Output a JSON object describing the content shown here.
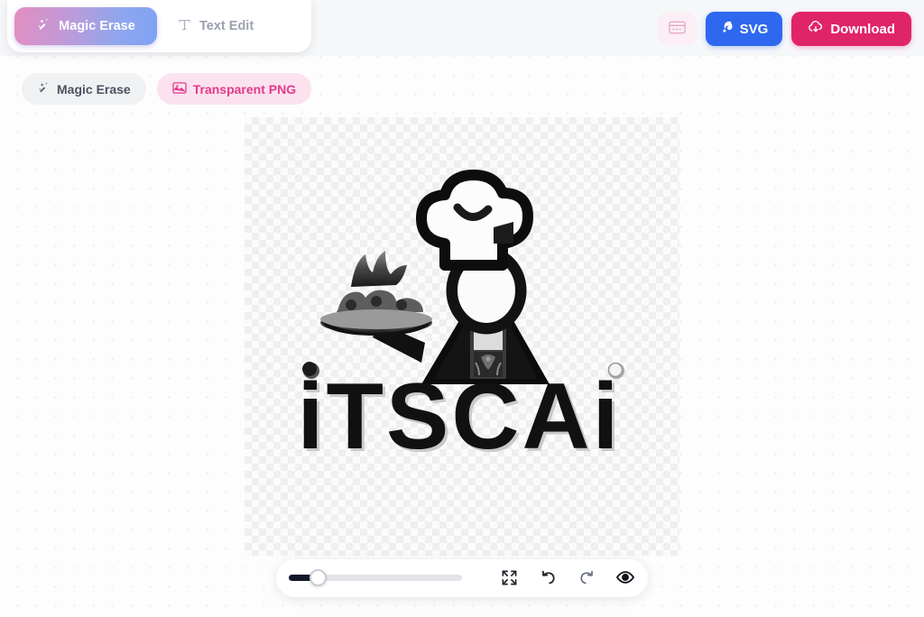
{
  "header": {
    "tabs": [
      {
        "label": "Magic Erase",
        "icon": "magic-wand-icon",
        "active": true
      },
      {
        "label": "Text Edit",
        "icon": "text-type-icon",
        "active": false
      }
    ],
    "actions": {
      "card_button": {
        "label": "",
        "icon": "credit-card-icon"
      },
      "svg_button": {
        "label": "SVG",
        "icon": "magic-swirl-icon",
        "color": "#2e68ee"
      },
      "download_button": {
        "label": "Download",
        "icon": "cloud-download-icon",
        "color": "#e02468"
      }
    }
  },
  "subbar": {
    "chips": [
      {
        "label": "Magic Erase",
        "icon": "magic-wand-icon",
        "active": false
      },
      {
        "label": "Transparent PNG",
        "icon": "transparent-image-icon",
        "active": true
      }
    ]
  },
  "canvas": {
    "artwork_alt": "iTSCAi chef logo",
    "logo_text": "iTSCAi",
    "background": "transparent-checkerboard"
  },
  "bottombar": {
    "zoom": {
      "value": 12,
      "min": 0,
      "max": 100
    },
    "buttons": [
      {
        "name": "fit-to-screen",
        "icon": "expand-icon"
      },
      {
        "name": "undo",
        "icon": "undo-arrow-icon"
      },
      {
        "name": "redo",
        "icon": "redo-arrow-icon"
      },
      {
        "name": "preview",
        "icon": "eye-icon"
      }
    ]
  },
  "colors": {
    "accent_pink": "#e02468",
    "accent_blue": "#2e68ee",
    "chip_pink_bg": "#fbe2ee",
    "chip_pink_text": "#e5398c",
    "page_bg": "#fdfdfe"
  }
}
